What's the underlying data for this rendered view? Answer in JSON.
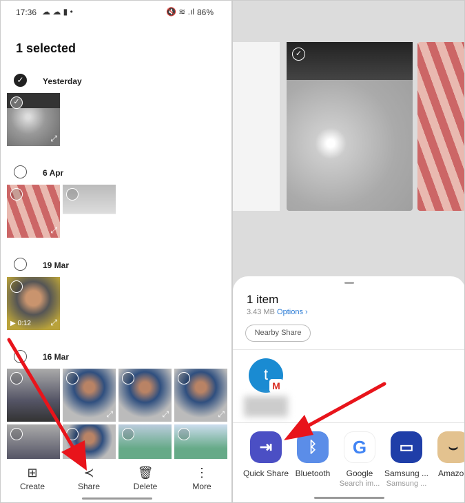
{
  "gallery": {
    "status": {
      "time": "17:36",
      "battery": "86%"
    },
    "title": "1 selected",
    "groups": [
      {
        "label": "Yesterday",
        "selected": true
      },
      {
        "label": "6 Apr",
        "selected": false
      },
      {
        "label": "19 Mar",
        "selected": false,
        "video_duration": "0:12"
      },
      {
        "label": "16 Mar",
        "selected": false
      }
    ],
    "bottom_nav": [
      {
        "label": "Create",
        "icon": "create-icon"
      },
      {
        "label": "Share",
        "icon": "share-icon"
      },
      {
        "label": "Delete",
        "icon": "trash-icon"
      },
      {
        "label": "More",
        "icon": "more-vertical-icon"
      }
    ]
  },
  "share_sheet": {
    "title": "1 item",
    "size": "3.43 MB",
    "options_label": "Options",
    "nearby_share": "Nearby Share",
    "contact_initial": "t",
    "apps": [
      {
        "label": "Quick Share",
        "sub": "",
        "color": "#4b4fc4"
      },
      {
        "label": "Bluetooth",
        "sub": "",
        "color": "#5b8de8"
      },
      {
        "label": "Google",
        "sub": "Search im...",
        "color": "#ffffff"
      },
      {
        "label": "Samsung ...",
        "sub": "Samsung ...",
        "color": "#1f3ea8"
      },
      {
        "label": "Amazon",
        "sub": "",
        "color": "#e3c28f"
      }
    ]
  },
  "annotation_color": "#e8141b"
}
